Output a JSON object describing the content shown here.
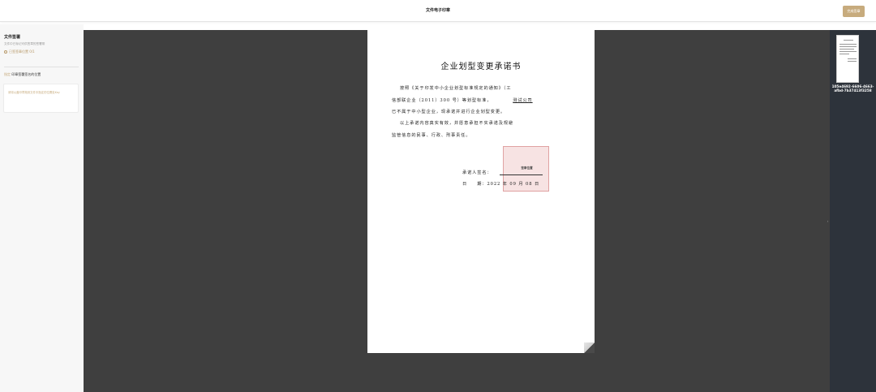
{
  "app": {
    "title": "文件电子印章",
    "done_label": "完成签章"
  },
  "sidebar": {
    "section_title": "文件签署",
    "section_desc": "文件中已标记可供签章的签署带",
    "signed_count": "已签签章位置 0/1",
    "sub_head_prefix": "指定",
    "sub_head_text": "印章签署签名的位置",
    "card_text": "请将以盖印章拖到文件中指定的位置处Key"
  },
  "document": {
    "heading": "企业划型变更承诺书",
    "line1": "按照《关于印发中小企业划型标准规定的通知》（工",
    "line2_a": "信部联企业（2011）300 号）等划型标准，",
    "line2_company": "测试公司",
    "line3": "已不属于中小型企业，现承诺并进行企业划型变更。",
    "line4": "以上承诺内容真实有效，并愿意承担不实承诺及规避",
    "line5": "监管信息的民事、行政、刑事责任。",
    "signer_label": "承诺人签名：",
    "stamp_label": "签章位置",
    "date_label": "日　　期：2022 年 09 月 08 日"
  },
  "thumbnail": {
    "name": "105e4692-6606-4663-afbd-7b37413f3258"
  },
  "colors": {
    "accent": "#c7ab7d",
    "main_bg": "#3f3f3f",
    "rail_bg": "#2d333b",
    "stamp_fill": "#f3dede"
  }
}
